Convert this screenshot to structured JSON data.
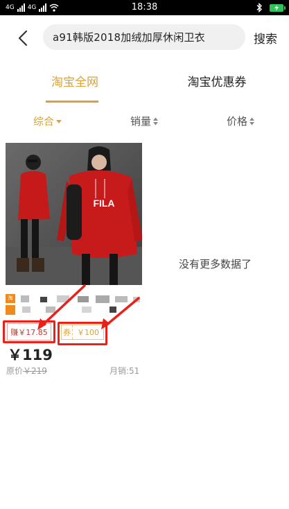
{
  "status_bar": {
    "sim1_label": "4G",
    "sim2_label": "4G",
    "time": "18:38"
  },
  "header": {
    "back_icon": "chevron-left-icon",
    "search_value": "a91韩版2018加绒加厚休闲卫衣",
    "search_button": "搜索"
  },
  "tabs": [
    {
      "label": "淘宝全网",
      "active": true
    },
    {
      "label": "淘宝优惠券",
      "active": false
    }
  ],
  "sort": [
    {
      "label": "综合",
      "active": true
    },
    {
      "label": "销量",
      "active": false
    },
    {
      "label": "价格",
      "active": false
    }
  ],
  "product": {
    "image_alt": "red hooded sweatshirt dress with FILA logo",
    "shop_badge": "淘",
    "earn_label": "赚￥17.85",
    "coupon_label": "券",
    "coupon_value": "￥100",
    "price": "￥119",
    "original_price_prefix": "原价",
    "original_price": "￥219",
    "sales": "月销:51"
  },
  "empty_state": "没有更多数据了",
  "colors": {
    "accent": "#d9a23a",
    "annotation": "#e8221a",
    "earn": "#c0392b"
  }
}
